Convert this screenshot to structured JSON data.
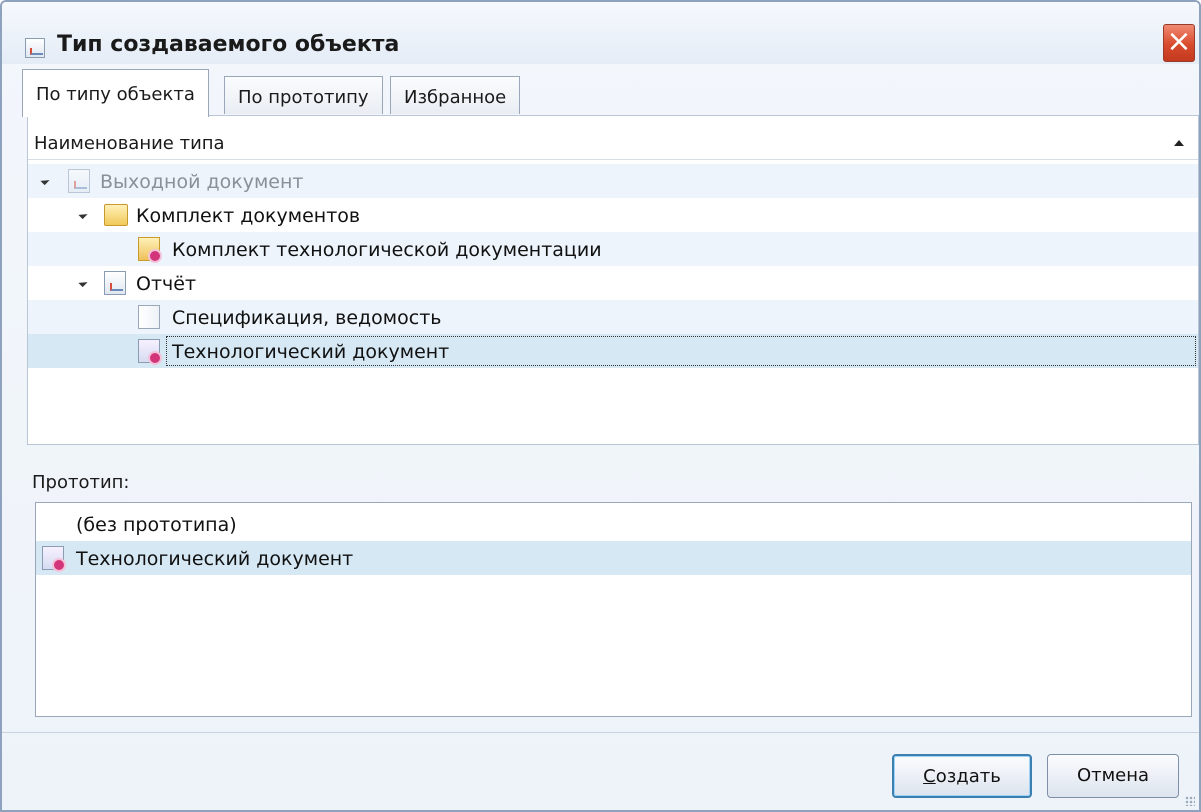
{
  "window": {
    "title": "Тип создаваемого объекта"
  },
  "tabs": [
    {
      "label": "По типу объекта",
      "active": true
    },
    {
      "label": "По прототипу",
      "active": false
    },
    {
      "label": "Избранное",
      "active": false
    }
  ],
  "type_list": {
    "column_header": "Наименование типа",
    "rows": [
      {
        "label": "Выходной документ",
        "icon": "output-document-icon",
        "expanded": true,
        "level": 0
      },
      {
        "label": "Комплект документов",
        "icon": "folder-icon",
        "expanded": true,
        "level": 1
      },
      {
        "label": "Комплект технологической документации",
        "icon": "document-kit-icon",
        "level": 2
      },
      {
        "label": "Отчёт",
        "icon": "report-icon",
        "expanded": true,
        "level": 1
      },
      {
        "label": "Спецификация, ведомость",
        "icon": "page-icon",
        "level": 2
      },
      {
        "label": "Технологический документ",
        "icon": "tech-document-icon",
        "level": 2,
        "selected": true
      }
    ]
  },
  "prototype": {
    "label": "Прототип:",
    "items": [
      {
        "label": "(без прототипа)",
        "selected": false
      },
      {
        "label": "Технологический документ",
        "icon": "tech-document-icon",
        "selected": true
      }
    ]
  },
  "buttons": {
    "create_hotkey": "С",
    "create_rest": "оздать",
    "cancel": "Отмена"
  },
  "colors": {
    "selection": "#d5e8f4",
    "alt_row": "#edf4fb",
    "close_button": "#d84a2c"
  }
}
